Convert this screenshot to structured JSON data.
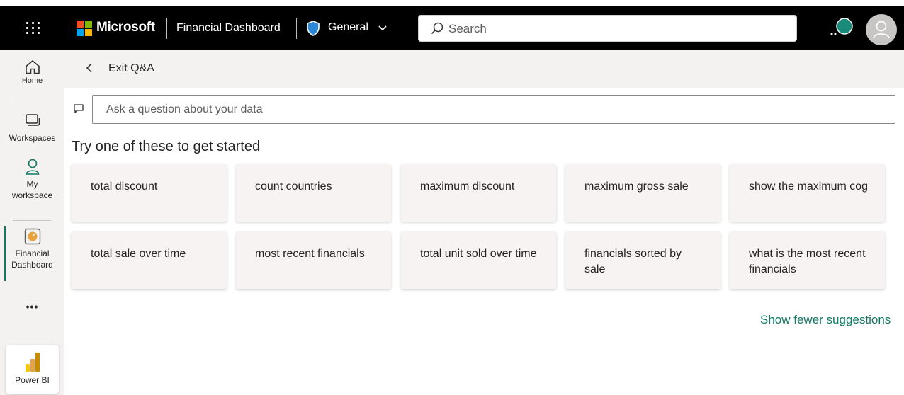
{
  "header": {
    "brand": "Microsoft",
    "app_title": "Financial Dashboard",
    "sensitivity_label": "General",
    "search_placeholder": "Search"
  },
  "left_nav": {
    "items": [
      {
        "label": "Home"
      },
      {
        "label": "Workspaces"
      },
      {
        "label_line1": "My",
        "label_line2": "workspace"
      },
      {
        "label_line1": "Financial",
        "label_line2": "Dashboard"
      }
    ],
    "more": "•••",
    "product": "Power BI"
  },
  "qa": {
    "exit_label": "Exit Q&A",
    "input_placeholder": "Ask a question about your data",
    "prompt_heading": "Try one of these to get started",
    "suggestions": [
      "total discount",
      "count countries",
      "maximum discount",
      "maximum gross sale",
      "show the maximum cog",
      "total sale over time",
      "most recent financials",
      "total unit sold over time",
      "financials sorted by sale",
      "what is the most recent financials"
    ],
    "show_fewer": "Show fewer suggestions"
  },
  "colors": {
    "topbar": "#000000",
    "accent": "#117865",
    "nav_bg": "#f3f2f1",
    "card_bg": "#f6f3f2"
  }
}
